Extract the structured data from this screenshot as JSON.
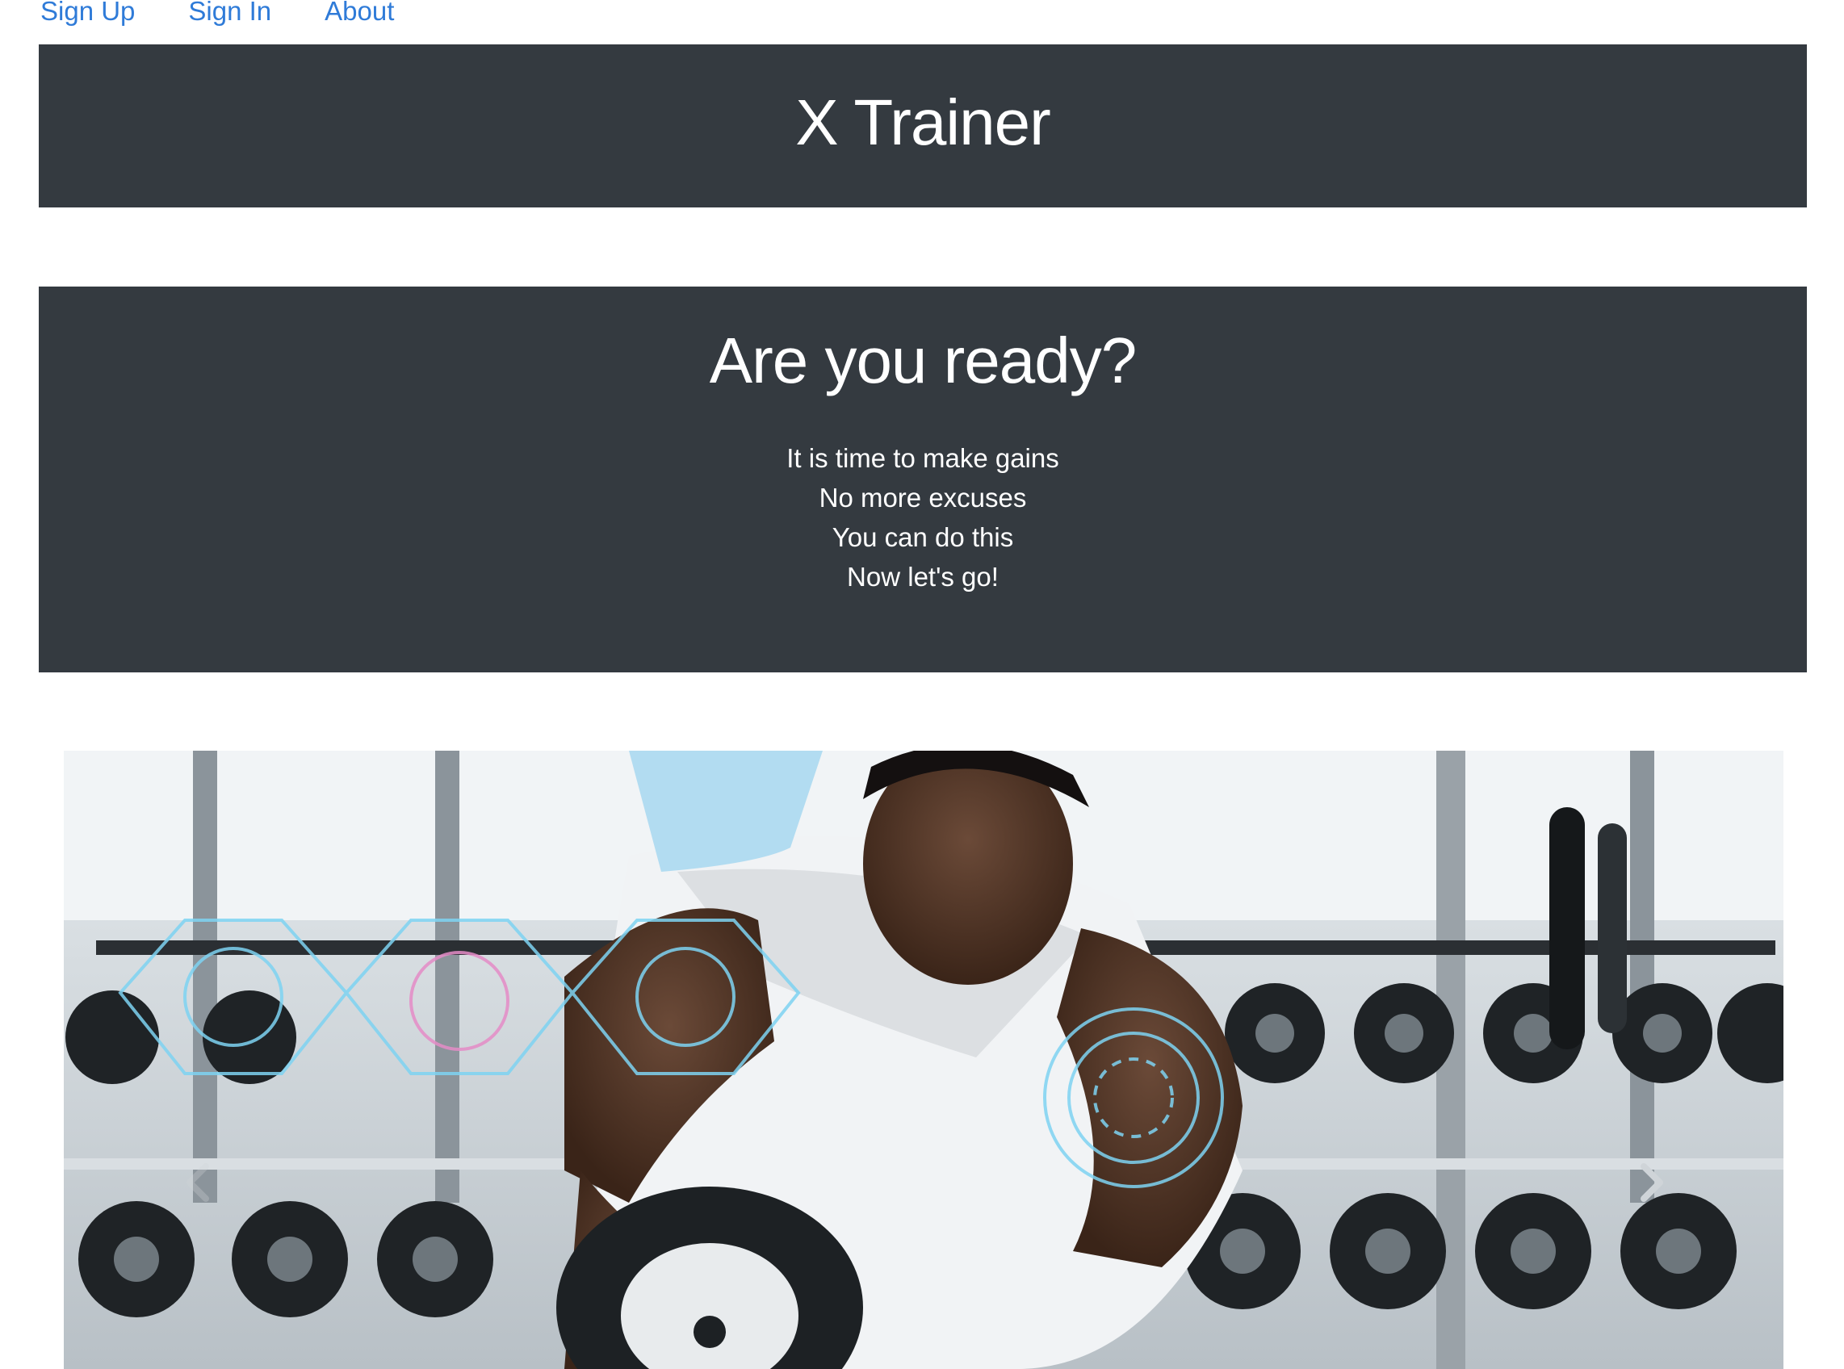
{
  "nav": {
    "signup": "Sign Up",
    "signin": "Sign In",
    "about": "About"
  },
  "brand": {
    "title": "X Trainer"
  },
  "hero": {
    "title": "Are you ready?",
    "lines": [
      "It is time to make gains",
      "No more excuses",
      "You can do this",
      "Now let's go!"
    ]
  },
  "carousel": {
    "prev_icon": "chevron-left-icon",
    "next_icon": "chevron-right-icon"
  },
  "colors": {
    "link": "#2f7bd8",
    "banner_bg": "#343a40",
    "banner_text": "#ffffff"
  }
}
